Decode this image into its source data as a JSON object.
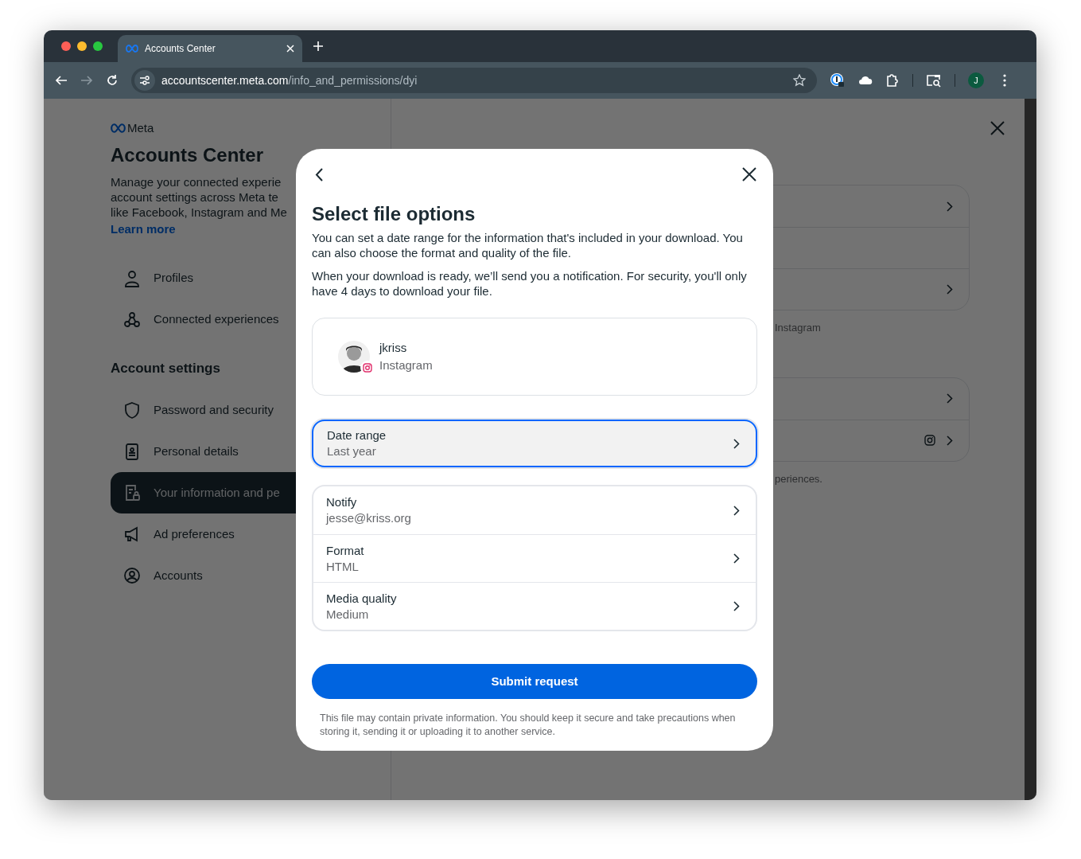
{
  "browser": {
    "tab_title": "Accounts Center",
    "url_host": "accountscenter.meta.com",
    "url_path": "/info_and_permissions/dyi",
    "profile_initial": "J"
  },
  "sidebar": {
    "brand": "Meta",
    "title": "Accounts Center",
    "description_lines": [
      "Manage your connected experie",
      "account settings across Meta te",
      "like Facebook, Instagram and Me"
    ],
    "learn_more": "Learn more",
    "items": [
      {
        "label": "Profiles",
        "selected": false
      },
      {
        "label": "Connected experiences",
        "selected": false
      }
    ],
    "section": "Account settings",
    "settings": [
      {
        "label": "Password and security",
        "selected": false
      },
      {
        "label": "Personal details",
        "selected": false
      },
      {
        "label": "Your information and pe",
        "selected": true
      },
      {
        "label": "Ad preferences",
        "selected": false
      },
      {
        "label": "Accounts",
        "selected": false
      }
    ]
  },
  "background": {
    "cards": [
      {
        "rows": [
          {
            "kind": "chevron"
          },
          {
            "kind": "plain"
          },
          {
            "kind": "chevron"
          }
        ],
        "note": "Instagram"
      },
      {
        "rows": [
          {
            "kind": "chevron"
          },
          {
            "kind": "instagram"
          }
        ],
        "note": "periences."
      }
    ]
  },
  "modal": {
    "title": "Select file options",
    "paragraphs": [
      "You can set a date range for the information that's included in your download. You can also choose the format and quality of the file.",
      "When your download is ready, we’ll send you a notification. For security, you'll only have 4 days to download your file."
    ],
    "account": {
      "username": "jkriss",
      "platform": "Instagram"
    },
    "date_range": {
      "label": "Date range",
      "value": "Last year",
      "focused": true
    },
    "options": [
      {
        "label": "Notify",
        "value": "jesse@kriss.org"
      },
      {
        "label": "Format",
        "value": "HTML"
      },
      {
        "label": "Media quality",
        "value": "Medium"
      }
    ],
    "submit": "Submit request",
    "footer": "This file may contain private information. You should keep it secure and take precautions when storing it, sending it or uploading it to another service."
  }
}
